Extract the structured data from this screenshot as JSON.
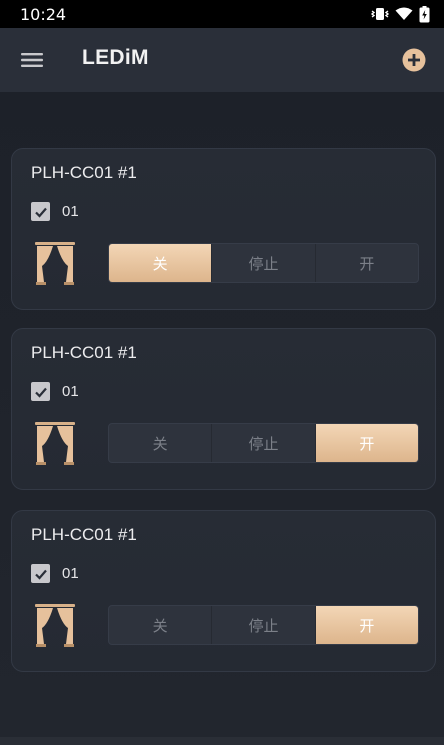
{
  "status_bar": {
    "time": "10:24"
  },
  "app_bar": {
    "title": "LEDiM"
  },
  "colors": {
    "accent": "#e6c19c",
    "card": "#272c35",
    "background": "#1f232b"
  },
  "cards": [
    {
      "title": "PLH-CC01 #1",
      "checkbox_label": "01",
      "checked": true,
      "buttons": [
        "关",
        "停止",
        "开"
      ],
      "active": "关"
    },
    {
      "title": "PLH-CC01 #1",
      "checkbox_label": "01",
      "checked": true,
      "buttons": [
        "关",
        "停止",
        "开"
      ],
      "active": "开"
    },
    {
      "title": "PLH-CC01 #1",
      "checkbox_label": "01",
      "checked": true,
      "buttons": [
        "关",
        "停止",
        "开"
      ],
      "active": "开"
    }
  ]
}
